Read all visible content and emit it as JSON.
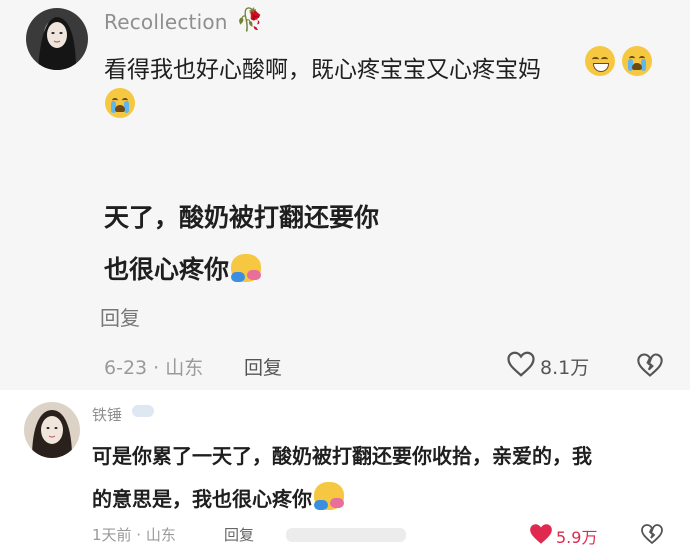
{
  "colors": {
    "top_background": "#f6f6f6",
    "liked_red": "#e0294e",
    "muted_text": "#9a9a9a"
  },
  "comment1": {
    "username": "Recollection",
    "username_icon": "rose-icon",
    "text": "看得我也好心酸啊，既心疼宝宝又心疼宝妈",
    "emojis": [
      "smiling-face-emoji",
      "crying-face-emoji",
      "crying-face-emoji"
    ],
    "quoted_line1": "天了，酸奶被打翻还要你",
    "quoted_line2": "也很心疼你",
    "quoted_line3": "回复",
    "date_location": "6-23 · 山东",
    "reply_label": "回复",
    "like_count": "8.1万"
  },
  "comment2": {
    "username": "铁锤",
    "username_icon": "cloud-icon",
    "text_line1": "可是你累了一天了，酸奶被打翻还要你收拾，亲爱的，我",
    "text_line2": "的意思是，我也很心疼你",
    "date_location": "1天前 · 山东",
    "reply_label": "回复",
    "like_count": "5.9万"
  }
}
